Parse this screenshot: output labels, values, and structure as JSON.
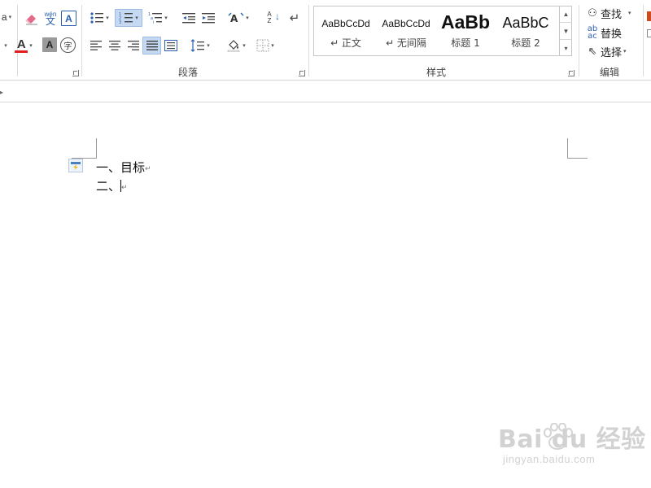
{
  "ribbon": {
    "groups": {
      "paragraph_label": "段落",
      "styles_label": "样式",
      "editing_label": "编辑"
    },
    "font": {
      "phonetic_top": "wén",
      "phonetic_bottom": "文",
      "border_char": "A",
      "font_color_char": "A",
      "shading_char": "A",
      "enclose_char": "字",
      "partial_left_glyph": "a",
      "clear_format_icon": "eraser-icon",
      "font_color_accent": "#e02020"
    },
    "paragraph": {
      "sort_top": "A",
      "sort_bottom": "Z",
      "show_marks": "↵",
      "numbering_active": true,
      "justify_active": true
    },
    "styles": [
      {
        "preview": "AaBbCcDd",
        "name": "↵ 正文"
      },
      {
        "preview": "AaBbCcDd",
        "name": "↵ 无间隔"
      },
      {
        "preview": "AaBb",
        "name": "标题 1"
      },
      {
        "preview": "AaBbC",
        "name": "标题 2"
      }
    ],
    "editing": {
      "find": "查找",
      "replace": "替换",
      "select": "选择"
    }
  },
  "document": {
    "lines": [
      {
        "prefix": "一、",
        "text": "目标",
        "mark": "↵"
      },
      {
        "prefix": "二、",
        "text": "",
        "mark": "↵"
      }
    ]
  },
  "watermark": {
    "main": "Bai du 经验",
    "sub": "jingyan.baidu.com"
  }
}
